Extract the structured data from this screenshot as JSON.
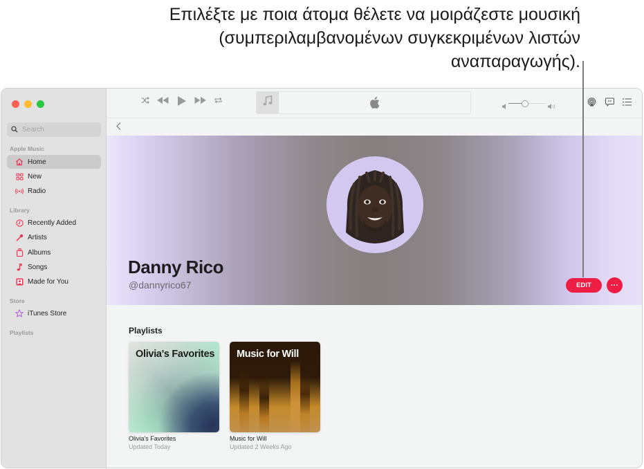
{
  "callout": {
    "text": "Επιλέξτε με ποια άτομα θέλετε να μοιράζεστε μουσική (συμπεριλαμβανομένων συγκεκριμένων λιστών αναπαραγωγής)."
  },
  "window": {
    "traffic_lights": {
      "close": "#fe5f57",
      "minimize": "#febc2e",
      "zoom": "#28c840"
    }
  },
  "sidebar": {
    "search_placeholder": "Search",
    "sections": [
      {
        "label": "Apple Music",
        "items": [
          {
            "label": "Home",
            "icon": "house-icon",
            "active": true
          },
          {
            "label": "New",
            "icon": "grid-icon"
          },
          {
            "label": "Radio",
            "icon": "broadcast-icon"
          }
        ]
      },
      {
        "label": "Library",
        "items": [
          {
            "label": "Recently Added",
            "icon": "clock-icon"
          },
          {
            "label": "Artists",
            "icon": "microphone-icon"
          },
          {
            "label": "Albums",
            "icon": "album-stack-icon"
          },
          {
            "label": "Songs",
            "icon": "music-note-icon"
          },
          {
            "label": "Made for You",
            "icon": "person-square-icon"
          }
        ]
      },
      {
        "label": "Store",
        "items": [
          {
            "label": "iTunes Store",
            "icon": "star-icon"
          }
        ]
      },
      {
        "label": "Playlists",
        "items": []
      }
    ]
  },
  "toolbar": {
    "controls": [
      "shuffle-icon",
      "rewind-icon",
      "play-icon",
      "fast-forward-icon",
      "repeat-icon"
    ],
    "now_playing_icon": "music-note-icon",
    "center_logo": "apple-logo-icon",
    "volume_percent": 45,
    "right_icons": [
      "airplay-icon",
      "lyrics-icon",
      "queue-list-icon"
    ]
  },
  "profile": {
    "name": "Danny Rico",
    "handle": "@dannyrico67",
    "edit_label": "EDIT",
    "more_label": "···"
  },
  "playlists": {
    "section_title": "Playlists",
    "items": [
      {
        "art_title": "Olivia's Favorites",
        "title": "Olivia's Favorites",
        "subtitle": "Updated Today"
      },
      {
        "art_title": "Music for Will",
        "title": "Music for Will",
        "subtitle": "Updated 2 Weeks Ago"
      }
    ]
  },
  "colors": {
    "accent": "#ee1d43",
    "sidebar_icon": "#f0304f",
    "store_icon": "#b34ee0"
  }
}
